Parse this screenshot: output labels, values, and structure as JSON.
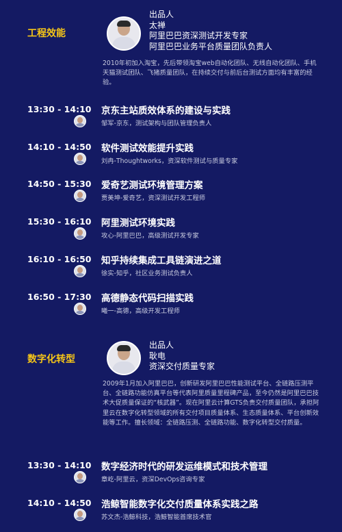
{
  "sections": [
    {
      "title": "工程效能",
      "producer": {
        "label": "出品人",
        "name": "太禅",
        "titles": [
          "阿里巴巴资深测试开发专家",
          "阿里巴巴业务平台质量团队负责人"
        ],
        "bio": "2010年初加入淘宝，先后带领淘宝web自动化团队、无线自动化团队、手机天猫测试团队、飞猪质量团队，在持续交付与前后台测试方面均有丰富的经验。"
      },
      "sessions": [
        {
          "time": "13:30 - 14:10",
          "title": "京东主站质效体系的建设与实践",
          "speaker": "邹军-京东，测试架构与团队管理负责人"
        },
        {
          "time": "14:10 - 14:50",
          "title": "软件测试效能提升实践",
          "speaker": "刘冉-Thoughtworks，资深软件测试与质量专家"
        },
        {
          "time": "14:50 - 15:30",
          "title": "爱奇艺测试环境管理方案",
          "speaker": "贾美坤-爱奇艺，资深测试开发工程师"
        },
        {
          "time": "15:30 - 16:10",
          "title": "阿里测试环境实践",
          "speaker": "攻心-阿里巴巴，高级测试开发专家"
        },
        {
          "time": "16:10 - 16:50",
          "title": "知乎持续集成工具链演进之道",
          "speaker": "徐实-知乎，社区业务测试负责人"
        },
        {
          "time": "16:50 - 17:30",
          "title": "高德静态代码扫描实践",
          "speaker": "曦一-高德，高级开发工程师"
        }
      ]
    },
    {
      "title": "数字化转型",
      "producer": {
        "label": "出品人",
        "name": "耿电",
        "titles": [
          "资深交付质量专家"
        ],
        "bio": "2009年1月加入阿里巴巴，创新研发阿里巴巴性能测试平台、全链路压测平台、全链路功能仿真平台等代表阿里质量里程碑产品，至今仍然是阿里巴巴技术大促质量保证的“核武器”。现在阿里云计算GTS负责交付质量团队，承担阿里云在数字化转型领域的所有交付项目质量体系、生态质量体系、平台创新效能等工作。擅长领域：全链路压测、全链路功能、数字化转型交付质量。"
      },
      "sessions": [
        {
          "time": "13:30 - 14:10",
          "title": "数字经济时代的研发运维模式和技术管理",
          "speaker": "章屹-阿里云，资深DevOps咨询专家"
        },
        {
          "time": "14:10 - 14:50",
          "title": "浩鲸智能数字化交付质量体系实践之路",
          "speaker": "苏文杰-浩鲸科技，浩鲸智能首席技术官"
        }
      ]
    }
  ]
}
